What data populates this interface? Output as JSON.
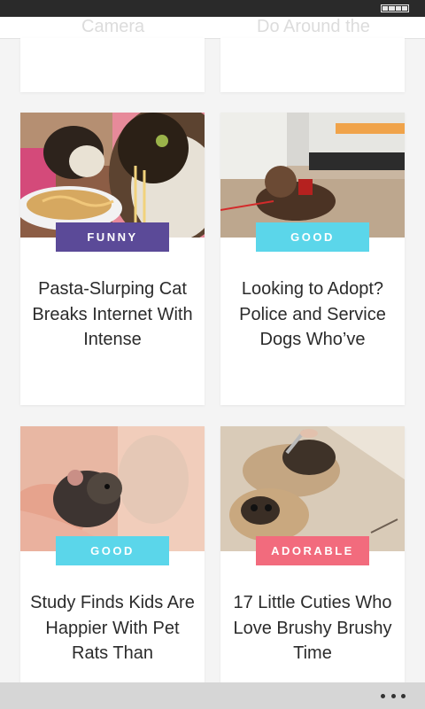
{
  "top_partial": {
    "left_title": "Camera",
    "right_title": "Do Around the"
  },
  "cards": [
    {
      "badge": "FUNNY",
      "badge_color": "#5b4a98",
      "title": "Pasta-Slurping Cat Breaks Internet With Intense"
    },
    {
      "badge": "GOOD",
      "badge_color": "#5bd6ea",
      "title": "Looking to Adopt? Police and Service Dogs Who’ve"
    },
    {
      "badge": "GOOD",
      "badge_color": "#5bd6ea",
      "title": "Study Finds Kids Are Happier With Pet Rats Than"
    },
    {
      "badge": "ADORABLE",
      "badge_color": "#f26b7d",
      "title": "17 Little Cuties Who Love Brushy Brushy Time"
    }
  ],
  "icons": {
    "menu": "more-horizontal-icon",
    "battery": "battery-icon"
  }
}
